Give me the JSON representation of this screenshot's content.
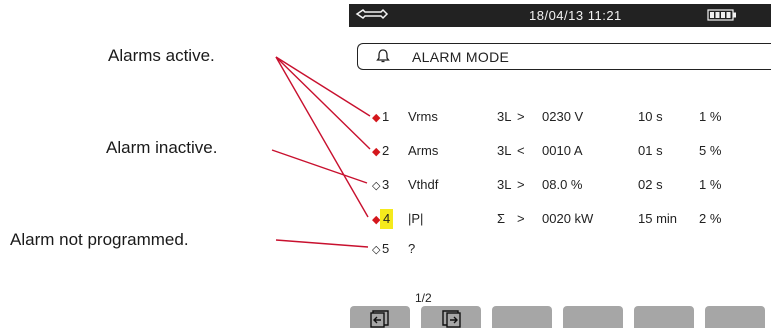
{
  "callouts": {
    "alarms_active": "Alarms active.",
    "alarm_inactive": "Alarm inactive.",
    "alarm_not_programmed": "Alarm not programmed."
  },
  "status_bar": {
    "datetime": "18/04/13 11:21",
    "icons": [
      "wrench-icon",
      "battery-icon"
    ]
  },
  "header": {
    "title": "ALARM MODE",
    "icon": "bell-icon"
  },
  "alarms": [
    {
      "marker": "◆",
      "index": "1",
      "parameter": "Vrms",
      "phase": "3L",
      "comparator": ">",
      "threshold": "0230 V",
      "duration": "10 s",
      "hysteresis": "1 %"
    },
    {
      "marker": "◆",
      "index": "2",
      "parameter": "Arms",
      "phase": "3L",
      "comparator": "<",
      "threshold": "0010 A",
      "duration": "01 s",
      "hysteresis": "5 %"
    },
    {
      "marker": "◇",
      "index": "3",
      "parameter": "Vthdf",
      "phase": "3L",
      "comparator": ">",
      "threshold": "08.0 %",
      "duration": "02 s",
      "hysteresis": "1 %"
    },
    {
      "marker": "◆",
      "index": "4",
      "parameter": "|P|",
      "phase": "Σ",
      "comparator": ">",
      "threshold": "0020 kW",
      "duration": "15 min",
      "hysteresis": "2 %"
    },
    {
      "marker": "◇",
      "index": "5",
      "parameter": "?"
    }
  ],
  "page_indicator": "1/2",
  "colors": {
    "active_marker": "#d4171c",
    "selection_highlight": "#f5ea1c",
    "function_key": "#a6a6a6",
    "status_bar": "#222222"
  }
}
